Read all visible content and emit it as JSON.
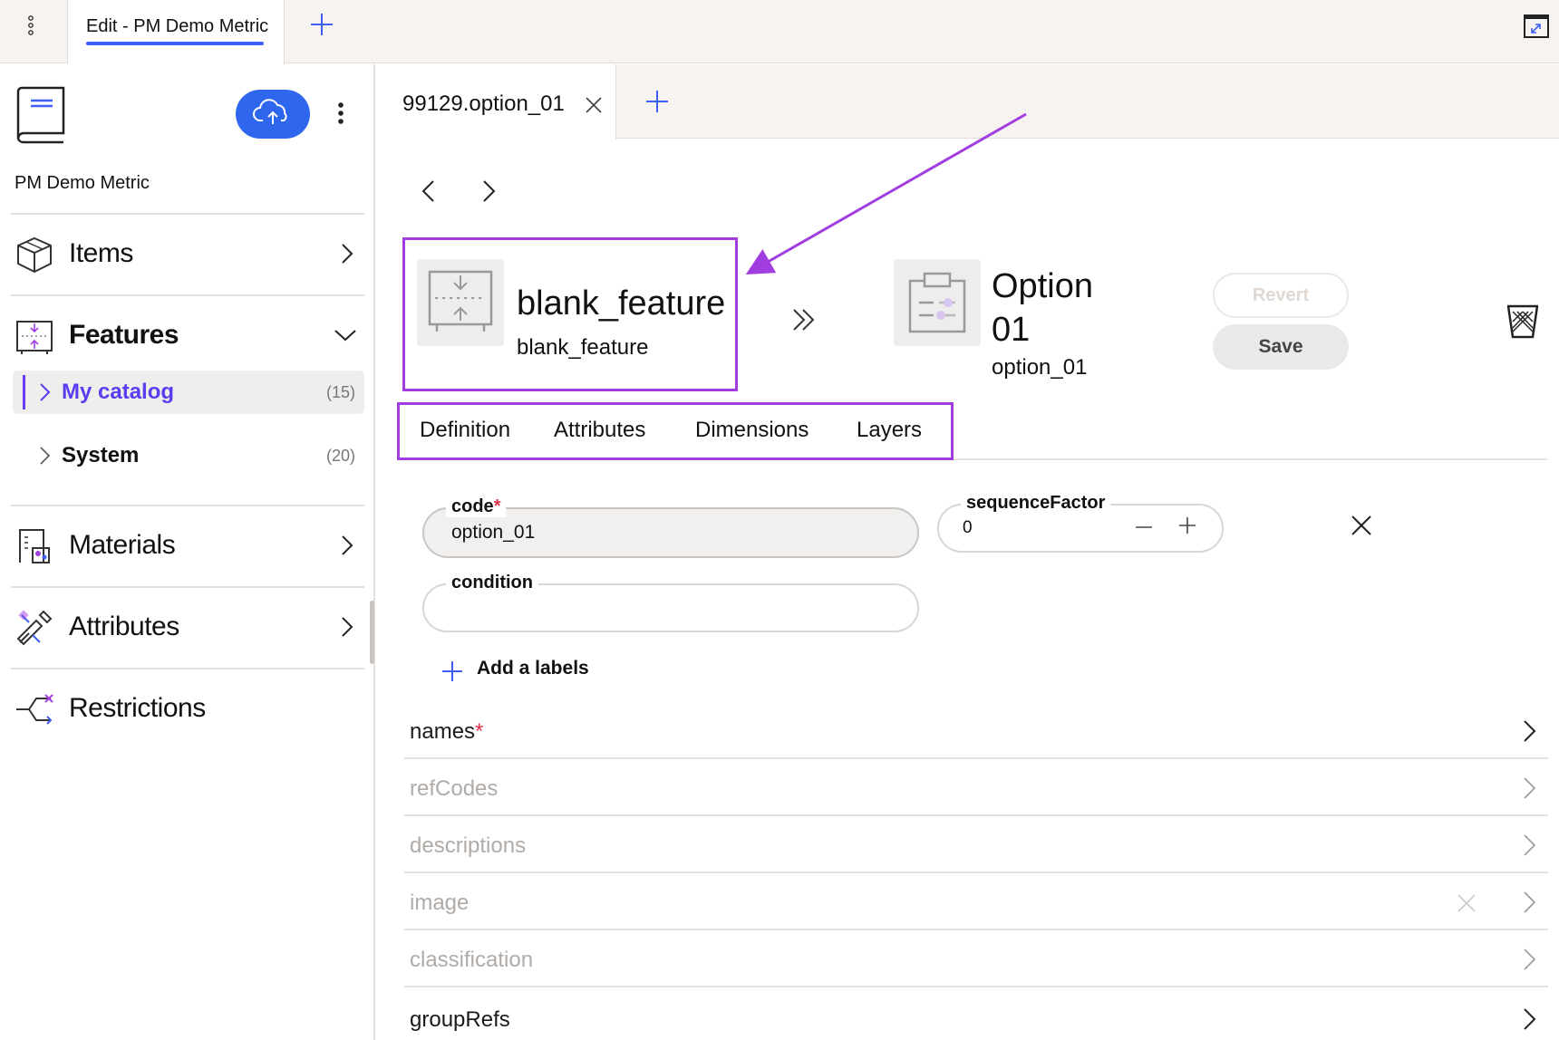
{
  "top_tab": {
    "title": "Edit - PM Demo Metric"
  },
  "sidebar": {
    "project_name": "PM Demo Metric",
    "items": [
      {
        "label": "Items",
        "icon": "box-icon"
      },
      {
        "label": "Features",
        "icon": "feature-icon"
      },
      {
        "label": "Materials",
        "icon": "materials-icon"
      },
      {
        "label": "Attributes",
        "icon": "attributes-icon"
      },
      {
        "label": "Restrictions",
        "icon": "restrictions-icon"
      }
    ],
    "features_children": [
      {
        "label": "My catalog",
        "count": "(15)"
      },
      {
        "label": "System",
        "count": "(20)"
      }
    ]
  },
  "doc_tab": {
    "title": "99129.option_01"
  },
  "feature": {
    "title": "blank_feature",
    "subtitle": "blank_feature"
  },
  "option": {
    "title": "Option 01",
    "subtitle": "option_01"
  },
  "buttons": {
    "revert": "Revert",
    "save": "Save"
  },
  "tabs": [
    "Definition",
    "Attributes",
    "Dimensions",
    "Layers"
  ],
  "form": {
    "code": {
      "label": "code",
      "required": "*",
      "value": "option_01"
    },
    "sequenceFactor": {
      "label": "sequenceFactor",
      "value": "0"
    },
    "condition": {
      "label": "condition",
      "value": ""
    },
    "add_labels": "Add a labels"
  },
  "properties": [
    {
      "label": "names",
      "required": "*"
    },
    {
      "label": "refCodes"
    },
    {
      "label": "descriptions"
    },
    {
      "label": "image"
    },
    {
      "label": "classification"
    },
    {
      "label": "groupRefs"
    }
  ],
  "colors": {
    "accent": "#2f66ee",
    "highlight": "#a23ee0",
    "active_item": "#6b3cf5",
    "required": "#e0324b"
  }
}
